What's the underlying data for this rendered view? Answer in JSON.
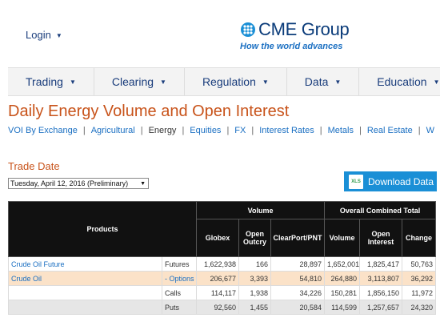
{
  "header": {
    "login_label": "Login",
    "logo_name": "CME Group",
    "logo_tagline": "How the world advances"
  },
  "nav": {
    "items": [
      {
        "label": "Trading"
      },
      {
        "label": "Clearing"
      },
      {
        "label": "Regulation"
      },
      {
        "label": "Data"
      },
      {
        "label": "Education"
      }
    ]
  },
  "page": {
    "title": "Daily Energy Volume and Open Interest"
  },
  "subnav": {
    "items": [
      "VOI By Exchange",
      "Agricultural",
      "Energy",
      "Equities",
      "FX",
      "Interest Rates",
      "Metals",
      "Real Estate",
      "W"
    ],
    "active": "Energy"
  },
  "trade_date": {
    "label": "Trade Date",
    "selected": "Tuesday, April 12, 2016 (Preliminary)"
  },
  "download": {
    "label": "Download Data",
    "icon_text": "XLS"
  },
  "table": {
    "group_headers": {
      "products": "Products",
      "volume": "Volume",
      "overall": "Overall Combined Total"
    },
    "columns": [
      "Globex",
      "Open Outcry",
      "ClearPort/PNT",
      "Volume",
      "Open Interest",
      "Change"
    ],
    "rows": [
      {
        "product": "Crude Oil Future",
        "type": "Futures",
        "globex": "1,622,938",
        "outcry": "166",
        "clearport": "28,897",
        "volume": "1,652,001",
        "oi": "1,825,417",
        "change": "50,763"
      },
      {
        "product": "Crude Oil",
        "type": "- Options",
        "globex": "206,677",
        "outcry": "3,393",
        "clearport": "54,810",
        "volume": "264,880",
        "oi": "3,113,807",
        "change": "36,292"
      },
      {
        "product": "",
        "type": "Calls",
        "globex": "114,117",
        "outcry": "1,938",
        "clearport": "34,226",
        "volume": "150,281",
        "oi": "1,856,150",
        "change": "11,972"
      },
      {
        "product": "",
        "type": "Puts",
        "globex": "92,560",
        "outcry": "1,455",
        "clearport": "20,584",
        "volume": "114,599",
        "oi": "1,257,657",
        "change": "24,320"
      }
    ]
  },
  "colors": {
    "accent_orange": "#c8531a",
    "link_blue": "#1a6fc2",
    "header_black": "#111111",
    "download_blue": "#1a8fd6"
  }
}
